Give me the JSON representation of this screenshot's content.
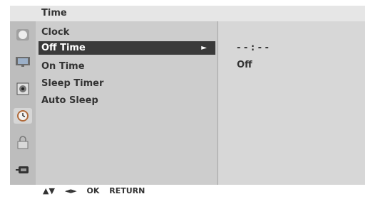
{
  "header": {
    "title": "Time"
  },
  "sidebar": {
    "icons": [
      {
        "name": "picture-icon"
      },
      {
        "name": "screen-icon"
      },
      {
        "name": "audio-icon"
      },
      {
        "name": "time-icon"
      },
      {
        "name": "lock-icon"
      },
      {
        "name": "input-icon"
      }
    ]
  },
  "menu": {
    "items": [
      {
        "label": "Clock"
      },
      {
        "label": "Off Time",
        "selected": true,
        "submenu_indicator": "►"
      },
      {
        "label": "On Time"
      },
      {
        "label": "Sleep Timer"
      },
      {
        "label": "Auto Sleep"
      }
    ]
  },
  "detail": {
    "time_value": "- - : - -",
    "status_value": "Off"
  },
  "footer": {
    "nav_up_down": "▲▼",
    "nav_left_right": "◄►",
    "ok_label": "OK",
    "return_label": "RETURN"
  }
}
